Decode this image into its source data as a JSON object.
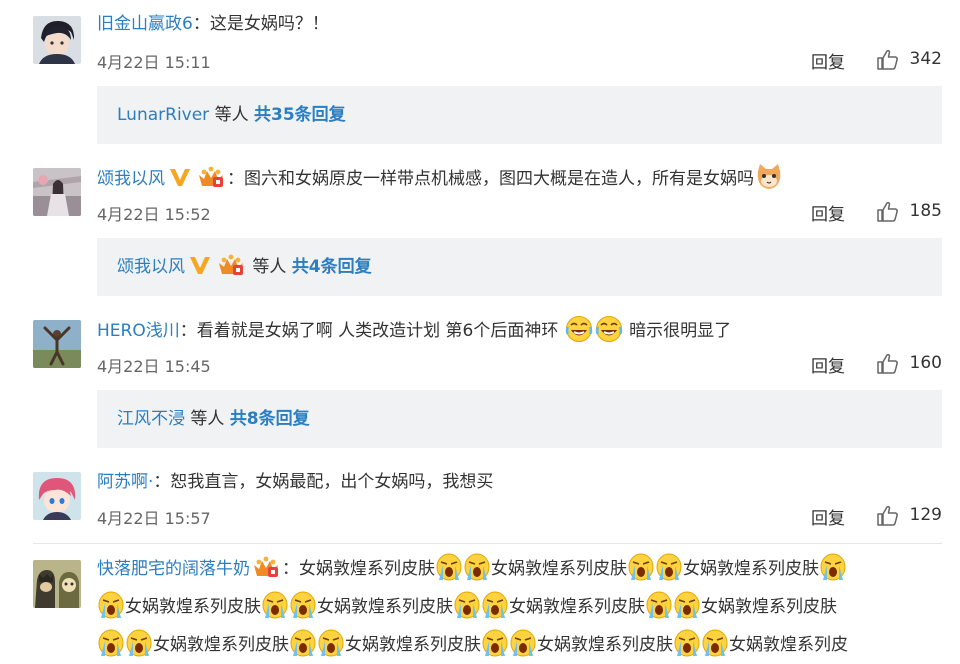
{
  "comments": [
    {
      "user": "旧金山嬴政6",
      "text": "这是女娲吗？！",
      "time": "4月22日 15:11",
      "reply_label": "回复",
      "likes": "342",
      "reply_box": {
        "user": "LunarRiver",
        "mid": "等人",
        "total": "共35条回复"
      }
    },
    {
      "user": "颂我以风",
      "text": "图六和女娲原皮一样带点机械感，图四大概是在造人，所有是女娲吗",
      "time": "4月22日 15:52",
      "reply_label": "回复",
      "likes": "185",
      "reply_box": {
        "user": "颂我以风",
        "mid": "等人",
        "total": "共4条回复"
      }
    },
    {
      "user": "HERO浅川",
      "text_a": "看着就是女娲了啊  人类改造计划 第6个后面神环",
      "text_b": "暗示很明显了",
      "time": "4月22日 15:45",
      "reply_label": "回复",
      "likes": "160",
      "reply_box": {
        "user": "江风不浸",
        "mid": "等人",
        "total": "共8条回复"
      }
    },
    {
      "user": "阿苏啊·",
      "text": "恕我直言，女娲最配，出个女娲吗，我想买",
      "time": "4月22日 15:57",
      "reply_label": "回复",
      "likes": "129"
    },
    {
      "user": "快落肥宅的阔落牛奶",
      "phrase": "女娲敦煌系列皮肤",
      "phrase_cut": "女娲敦煌系列皮"
    }
  ],
  "colors": {
    "link": "#2b7ec1",
    "text": "#333333",
    "meta": "#666666",
    "reply_bg": "#f0f2f3",
    "vip_v": "#f5a623"
  },
  "icons": [
    "thumbs-up-icon",
    "verified-v-icon",
    "crown-badge-icon",
    "laugh-cry-emoji",
    "crying-emoji",
    "cat-emoji"
  ]
}
